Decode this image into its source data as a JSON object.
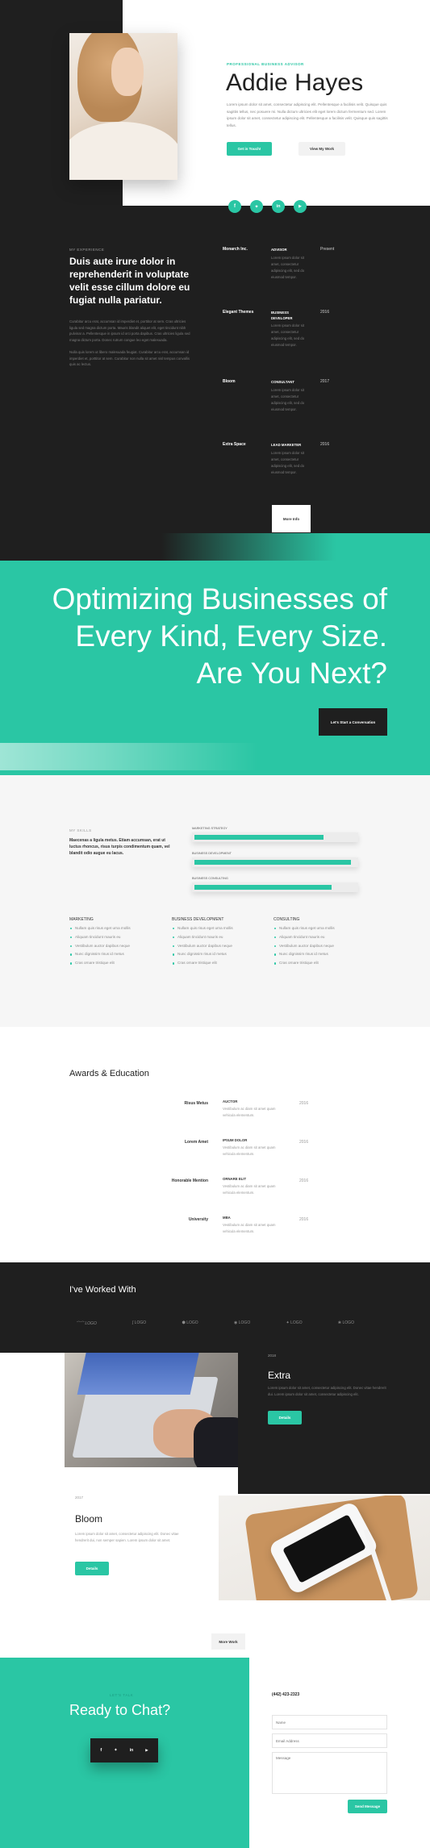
{
  "hero": {
    "eyebrow": "PROFESSIONAL BUSINESS ADVISOR",
    "name": "Addie Hayes",
    "bio": "Lorem ipsum dolor sit amet, consectetur adipiscing elit. Pellentesque a facilisis velit. Quisque quis sagittis tellus, nec posuere mi. Nulla dictum ultricies elit eget lorem dictum fermentum sed. Lorem ipsum dolor sit amet, consectetur adipiscing elit. Pellentesque a facilisis velit. Quisque quis sagittis tellus.",
    "primary_button": "Get in Touch!",
    "secondary_button": "View My Work"
  },
  "social": [
    "facebook-icon",
    "twitter-icon",
    "linkedin-icon",
    "youtube-icon"
  ],
  "experience": {
    "eyebrow": "MY EXPERIENCE",
    "heading": "Duis aute irure dolor in reprehenderit in voluptate velit esse cillum dolore eu fugiat nulla pariatur.",
    "para1": "Curabitur arcu erat, accumsan id imperdiet et, porttitor at sem. Cras ultricies ligula sed magna dictum porta. Mauris blandit aliquet elit, eget tincidunt nibh pulvinar a. Pellentesque in ipsum id orci porta dapibus. Cras ultricies ligula sed magna dictum porta. Donec rutrum congue leo eget malesuada.",
    "para2": "Nulla quis lorem ut libero malesuada feugiat. Curabitur arcu erat, accumsan id imperdiet et, porttitor at sem. Curabitur non nulla sit amet nisl tempus convallis quis ac lectus.",
    "jobs": [
      {
        "company": "Monarch Inc.",
        "role": "ADVISOR",
        "desc": "Lorem ipsum dolor sit amet, consectetur adipiscing elit, sed do eiusmod tempor.",
        "year": "Present"
      },
      {
        "company": "Elegant Themes",
        "role": "BUSINESS DEVELOPER",
        "desc": "Lorem ipsum dolor sit amet, consectetur adipiscing elit, sed do eiusmod tempor.",
        "year": "2016"
      },
      {
        "company": "Bloom",
        "role": "CONSULTANT",
        "desc": "Lorem ipsum dolor sit amet, consectetur adipiscing elit, sed do eiusmod tempor.",
        "year": "2017"
      },
      {
        "company": "Extra Space",
        "role": "LEAD MARKETER",
        "desc": "Lorem ipsum dolor sit amet, consectetur adipiscing elit, sed do eiusmod tempor.",
        "year": "2016"
      }
    ],
    "more_button": "More Info"
  },
  "cta": {
    "heading": "Optimizing Businesses of Every Kind, Every Size. Are You Next?",
    "button": "Let's Start a Conversation"
  },
  "skills": {
    "eyebrow": "MY SKILLS",
    "text": "Maecenas a ligula metus. Etiam accumsan, erat ut luctus rhoncus, risus turpis condimentum quam, vel blandit odio augue eu lacus.",
    "bars": [
      {
        "label": "MARKETING STRATEGY",
        "value": 0.8
      },
      {
        "label": "BUSINESS DEVELOPMENT",
        "value": 0.97
      },
      {
        "label": "BUSINESS CONSULTING",
        "value": 0.85
      }
    ],
    "columns": [
      {
        "title": "MARKETING",
        "items": [
          "Nullam quis risus eget urna mollis",
          "Aliquam tincidunt mauris eu",
          "Vestibulum auctor dapibus neque",
          "Nunc dignissim risus id metus",
          "Cras ornare tristique elit"
        ]
      },
      {
        "title": "BUSINESS DEVELOPMENT",
        "items": [
          "Nullam quis risus eget urna mollis",
          "Aliquam tincidunt mauris eu",
          "Vestibulum auctor dapibus neque",
          "Nunc dignissim risus id metus",
          "Cras ornare tristique elit"
        ]
      },
      {
        "title": "CONSULTING",
        "items": [
          "Nullam quis risus eget urna mollis",
          "Aliquam tincidunt mauris eu",
          "Vestibulum auctor dapibus neque",
          "Nunc dignissim risus id metus",
          "Cras ornare tristique elit"
        ]
      }
    ]
  },
  "awards": {
    "heading": "Awards & Education",
    "items": [
      {
        "name": "Risus Metus",
        "role": "AUCTOR",
        "desc": "Vestibulum ac diam sit amet quam vehicula elementum.",
        "year": "2016"
      },
      {
        "name": "Lorem Amet",
        "role": "IPSUM DOLOR",
        "desc": "Vestibulum ac diam sit amet quam vehicula elementum.",
        "year": "2016"
      },
      {
        "name": "Honorable Mention",
        "role": "ORNARE ELIT",
        "desc": "Vestibulum ac diam sit amet quam vehicula elementum.",
        "year": "2016"
      },
      {
        "name": "University",
        "role": "MBA",
        "desc": "Vestibulum ac diam sit amet quam vehicula elementum.",
        "year": "2016"
      }
    ]
  },
  "clients": {
    "heading": "I've Worked With",
    "logos": [
      "LOGO",
      "LOGO",
      "LOGO",
      "LOGO",
      "LOGO",
      "LOGO"
    ]
  },
  "projects": [
    {
      "year": "2018",
      "title": "Extra",
      "desc": "Lorem ipsum dolor sit amet, consectetur adipiscing elit. Donec vitae hendrerit dui. Lorem ipsum dolor sit amet, consectetur adipiscing elit.",
      "button": "Details"
    },
    {
      "year": "2017",
      "title": "Bloom",
      "desc": "Lorem ipsum dolor sit amet, consectetur adipiscing elit. Donec vitae hendrerit dui, non semper sapien. Lorem ipsum dolor sit amet.",
      "button": "Details"
    }
  ],
  "more_work": "More Work",
  "contact": {
    "eyebrow": "LET'S TALK",
    "heading": "Ready to Chat?",
    "phone": "(442) 423-2323",
    "name_placeholder": "Name",
    "email_placeholder": "Email Address",
    "message_placeholder": "Message",
    "submit": "Send Message"
  },
  "colors": {
    "accent": "#2ac6a4",
    "dark": "#1f1f1f",
    "light": "#f5f5f5"
  }
}
